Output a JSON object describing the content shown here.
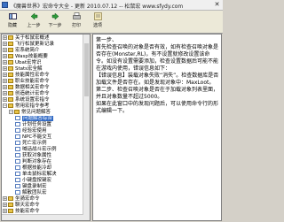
{
  "window": {
    "title": "《魔兽世界》宏命令大全 - 更新 2010.07.12 -- 松鼠宏 www.sfydy.com",
    "close_glyph": "✕"
  },
  "toolbar": {
    "buttons": [
      {
        "label": "隐藏",
        "icon": "hide-icon"
      },
      {
        "label": "上一步",
        "icon": "back-icon"
      },
      {
        "label": "下一步",
        "icon": "forward-icon"
      },
      {
        "label": "打印",
        "icon": "print-icon"
      },
      {
        "label": "选项",
        "icon": "options-icon"
      }
    ]
  },
  "tree": {
    "items": [
      {
        "text": "关于松鼠宏概述",
        "level": 0,
        "kind": "book",
        "expander": "+"
      },
      {
        "text": "飞行松鼠更新记录",
        "level": 0,
        "kind": "book",
        "expander": "+"
      },
      {
        "text": "宏系统简介",
        "level": 0,
        "kind": "book",
        "expander": "+"
      },
      {
        "text": "Wasp技能概要",
        "level": 0,
        "kind": "book",
        "expander": "+"
      },
      {
        "text": "Ubat宏常识",
        "level": 0,
        "kind": "book",
        "expander": "+"
      },
      {
        "text": "Stats宏全解",
        "level": 0,
        "kind": "book",
        "expander": "+"
      },
      {
        "text": "技能属性宏命令",
        "level": 0,
        "kind": "book",
        "expander": "+"
      },
      {
        "text": "职业技能宏命令",
        "level": 0,
        "kind": "book",
        "expander": "+"
      },
      {
        "text": "数据相关宏命令",
        "level": 0,
        "kind": "book",
        "expander": "+"
      },
      {
        "text": "创造统计宏命令",
        "level": 0,
        "kind": "book",
        "expander": "+"
      },
      {
        "text": "系统设置宏指令",
        "level": 0,
        "kind": "book",
        "expander": "+"
      },
      {
        "text": "常用宏指令参考",
        "level": 0,
        "kind": "book",
        "expander": "−"
      },
      {
        "text": "常见问题解答",
        "level": 1,
        "kind": "book",
        "expander": "−"
      },
      {
        "text": "问题解答综合",
        "level": 2,
        "kind": "page",
        "selected": true
      },
      {
        "text": "计划任务设置",
        "level": 2,
        "kind": "page"
      },
      {
        "text": "经验宏使用",
        "level": 2,
        "kind": "page"
      },
      {
        "text": "NPC不能交互",
        "level": 2,
        "kind": "page"
      },
      {
        "text": "死亡宏示例",
        "level": 2,
        "kind": "page"
      },
      {
        "text": "喊话战斗宏示例",
        "level": 2,
        "kind": "page"
      },
      {
        "text": "获取对象属性",
        "level": 2,
        "kind": "page"
      },
      {
        "text": "判断对象存在",
        "level": 2,
        "kind": "page"
      },
      {
        "text": "根据技能冷却",
        "level": 2,
        "kind": "page"
      },
      {
        "text": "单击鼠标宏解决",
        "level": 2,
        "kind": "page"
      },
      {
        "text": "小键盘按键宏",
        "level": 2,
        "kind": "page"
      },
      {
        "text": "键盘录制宏",
        "level": 2,
        "kind": "page"
      },
      {
        "text": "解散团队宏",
        "level": 2,
        "kind": "page"
      },
      {
        "text": "坐骑宏命令",
        "level": 0,
        "kind": "book",
        "expander": "+"
      },
      {
        "text": "聊天宏命令",
        "level": 0,
        "kind": "book",
        "expander": "+"
      },
      {
        "text": "技能宏命令",
        "level": 0,
        "kind": "book",
        "expander": "+"
      }
    ]
  },
  "content": {
    "paragraphs": [
      "第一步、",
      "首先检查召唤的对象是否有效，如有检查召唤对象是否存在(Monster,RL)，有不设置就修改设置该命令。如没有设置需要添加，检查设置数据后可能不能在游戏内使用，错误信息如下：",
      "【错误信息】装载对象失败“消失”。检查数据库是否加载文件是否存在。如是发现对象中：MaxLoot。",
      "第二步、检查召唤对象是否在于加载对象列表里面，并且对象数量不超过5000。",
      "如果在此窗口中的发现问题后，可以使用命令行的形式编辑一下。"
    ]
  },
  "colors": {
    "selection": "#316ac5",
    "window_bg": "#d4d0c8",
    "toolbar_bg": "#ece9d8"
  }
}
